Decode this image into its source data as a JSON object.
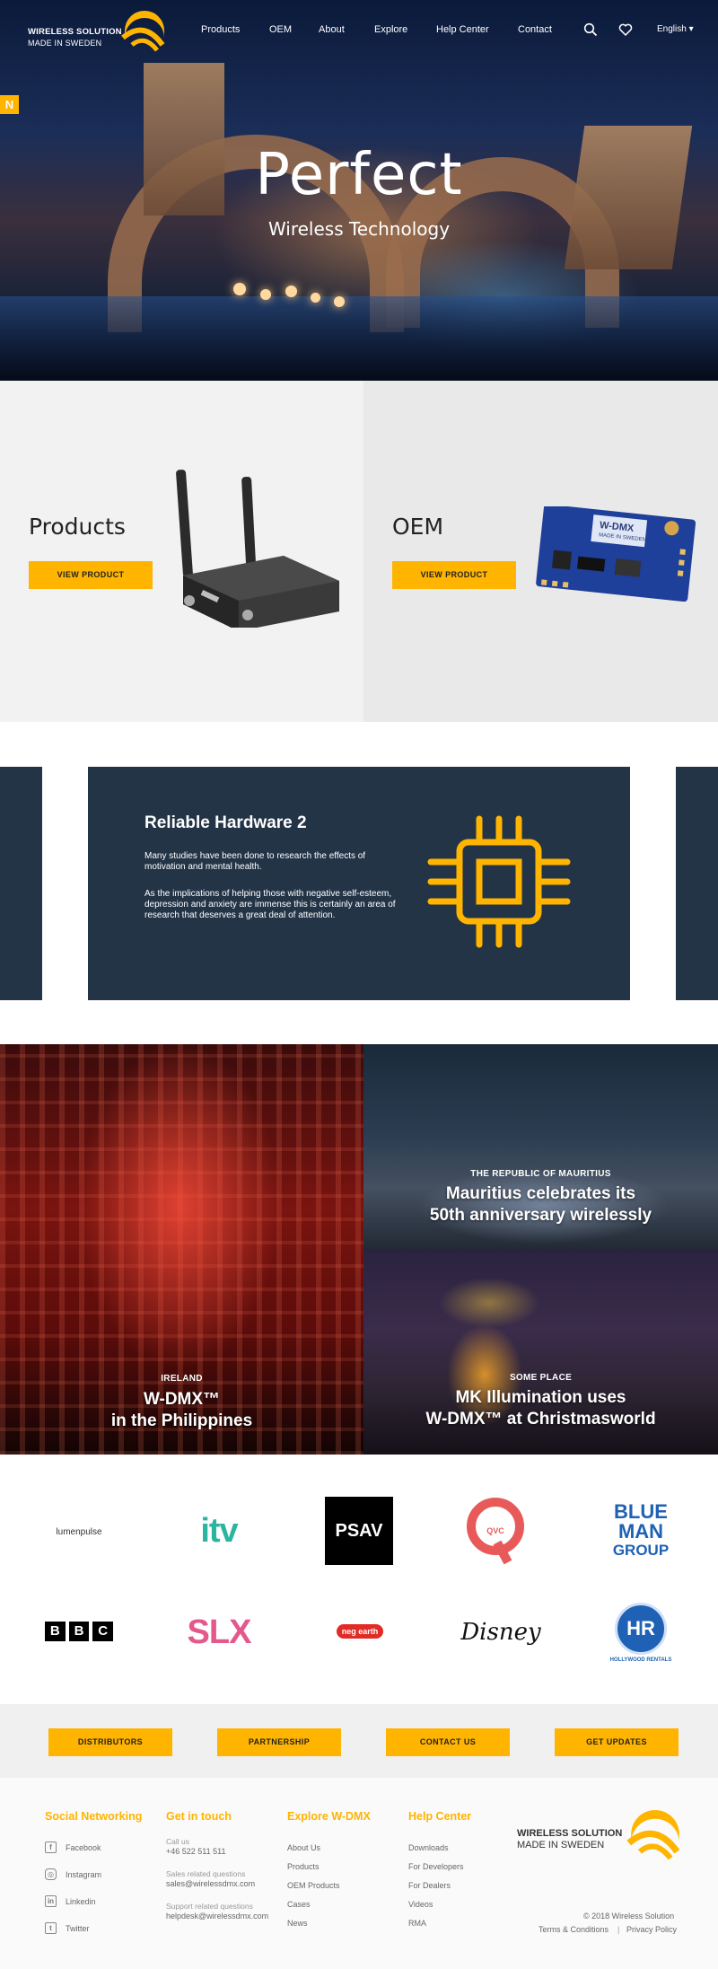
{
  "brand": {
    "line1": "WIRELESS SOLUTION",
    "line2": "MADE IN SWEDEN",
    "accent": "#ffb400"
  },
  "nav": {
    "items": [
      "Products",
      "OEM",
      "About",
      "Explore",
      "Help Center",
      "Contact"
    ],
    "language": "English ▾",
    "icons": [
      "search-icon",
      "heart-icon"
    ]
  },
  "hero": {
    "badge": "N",
    "title": "Perfect",
    "subtitle": "Wireless Technology"
  },
  "panels": {
    "products": {
      "title": "Products",
      "button": "VIEW PRODUCT"
    },
    "oem": {
      "title": "OEM",
      "button": "VIEW PRODUCT",
      "board_label": "W-DMX",
      "board_sub": "MADE IN SWEDEN"
    }
  },
  "feature": {
    "title": "Reliable Hardware 2",
    "p1": "Many studies have been done to research the effects of motivation and mental health.",
    "p2": "As the implications of helping those with negative self-esteem, depression and anxiety are immense this is certainly an area of research that deserves a great deal of attention.",
    "bg": "#233447"
  },
  "news": [
    {
      "location": "IRELAND",
      "title_l1": "W-DMX™",
      "title_l2": "in the Philippines"
    },
    {
      "location": "THE REPUBLIC OF MAURITIUS",
      "title_l1": "Mauritius celebrates its",
      "title_l2": "50th anniversary wirelessly"
    },
    {
      "location": "SOME PLACE",
      "title_l1": "MK Illumination uses",
      "title_l2": "W-DMX™ at Christmasworld"
    }
  ],
  "partners": {
    "lumenpulse": "lumenpulse",
    "itv": "itv",
    "psav": "PSAV",
    "qvc": "QVC",
    "blueman": [
      "BLUE",
      "MAN",
      "GROUP"
    ],
    "bbc": [
      "B",
      "B",
      "C"
    ],
    "slx": "SLX",
    "neg": "neg earth",
    "disney": "Disney",
    "hollywood_mark": "HR",
    "hollywood": "HOLLYWOOD RENTALS"
  },
  "cta": [
    "DISTRIBUTORS",
    "PARTNERSHIP",
    "CONTACT US",
    "GET UPDATES"
  ],
  "footer": {
    "social": {
      "heading": "Social Networking",
      "items": [
        "Facebook",
        "Instagram",
        "Linkedin",
        "Twitter"
      ]
    },
    "contact": {
      "heading": "Get in touch",
      "call_label": "Call us",
      "phone": "+46 522 511 511",
      "sales_label": "Sales related questions",
      "sales_email": "sales@wirelessdmx.com",
      "support_label": "Support related questions",
      "support_email": "helpdesk@wirelessdmx.com"
    },
    "explore": {
      "heading": "Explore W-DMX",
      "items": [
        "About Us",
        "Products",
        "OEM Products",
        "Cases",
        "News"
      ]
    },
    "help": {
      "heading": "Help Center",
      "items": [
        "Downloads",
        "For Developers",
        "For Dealers",
        "Videos",
        "RMA"
      ]
    },
    "copyright": "© 2018 Wireless Solution",
    "terms": "Terms & Conditions",
    "separator": "|",
    "privacy": "Privacy Policy"
  }
}
